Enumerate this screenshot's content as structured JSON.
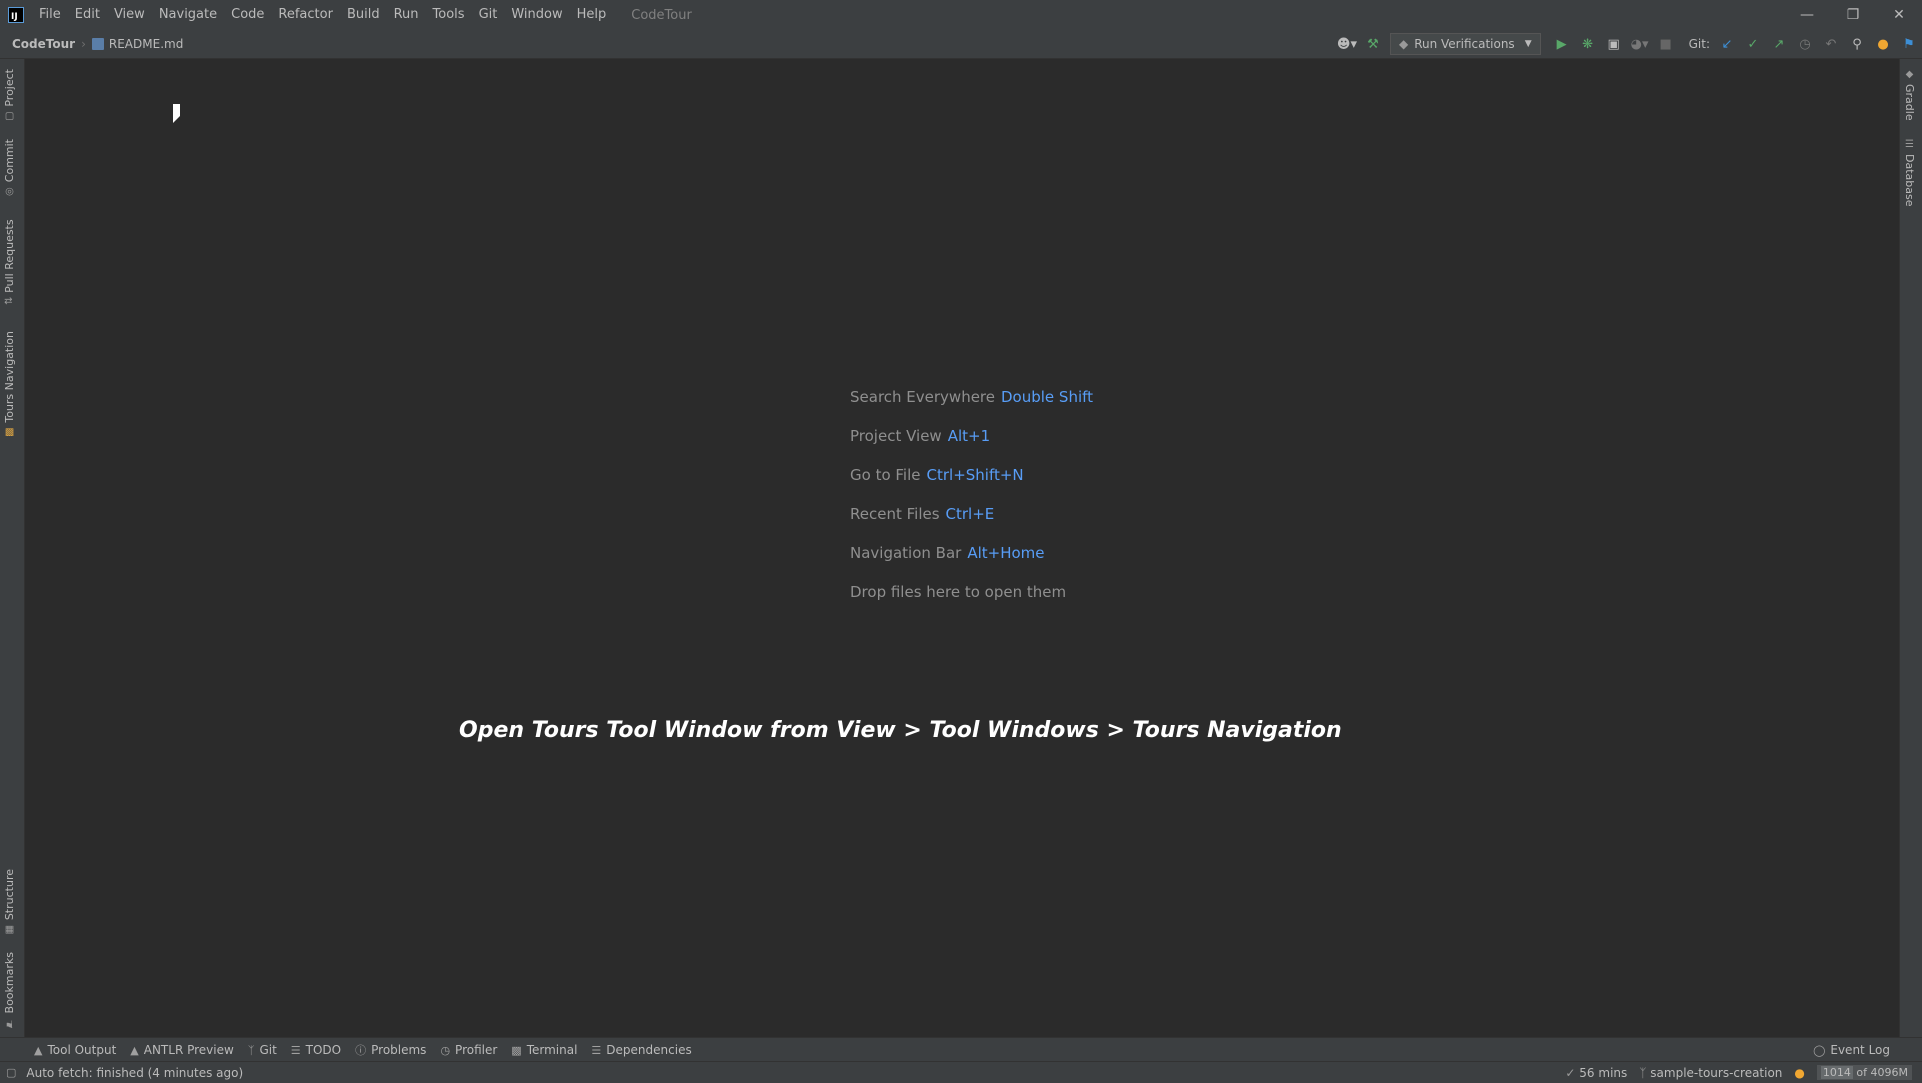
{
  "menu": {
    "items": [
      "File",
      "Edit",
      "View",
      "Navigate",
      "Code",
      "Refactor",
      "Build",
      "Run",
      "Tools",
      "Git",
      "Window",
      "Help"
    ],
    "project_title": "CodeTour"
  },
  "breadcrumb": {
    "project": "CodeTour",
    "file": "README.md"
  },
  "toolbar": {
    "run_config": "Run Verifications",
    "git_label": "Git:"
  },
  "left_tabs": [
    "Project",
    "Commit",
    "Pull Requests",
    "Tours Navigation",
    "Structure",
    "Bookmarks"
  ],
  "right_tabs": [
    "Gradle",
    "Database"
  ],
  "hints": [
    {
      "label": "Search Everywhere",
      "key": "Double Shift"
    },
    {
      "label": "Project View",
      "key": "Alt+1"
    },
    {
      "label": "Go to File",
      "key": "Ctrl+Shift+N"
    },
    {
      "label": "Recent Files",
      "key": "Ctrl+E"
    },
    {
      "label": "Navigation Bar",
      "key": "Alt+Home"
    }
  ],
  "drop_hint": "Drop files here to open them",
  "overlay_text": "Open Tours Tool Window from View > Tool Windows > Tours Navigation",
  "tool_windows": [
    "Tool Output",
    "ANTLR Preview",
    "Git",
    "TODO",
    "Problems",
    "Profiler",
    "Terminal",
    "Dependencies"
  ],
  "event_log": "Event Log",
  "status": {
    "message": "Auto fetch: finished (4 minutes ago)",
    "time": "56 mins",
    "branch": "sample-tours-creation",
    "memory_used": "1014",
    "memory_total": " of 4096M"
  },
  "colors": {
    "accent": "#589df6",
    "background": "#2b2b2b",
    "chrome": "#3c3f41"
  }
}
